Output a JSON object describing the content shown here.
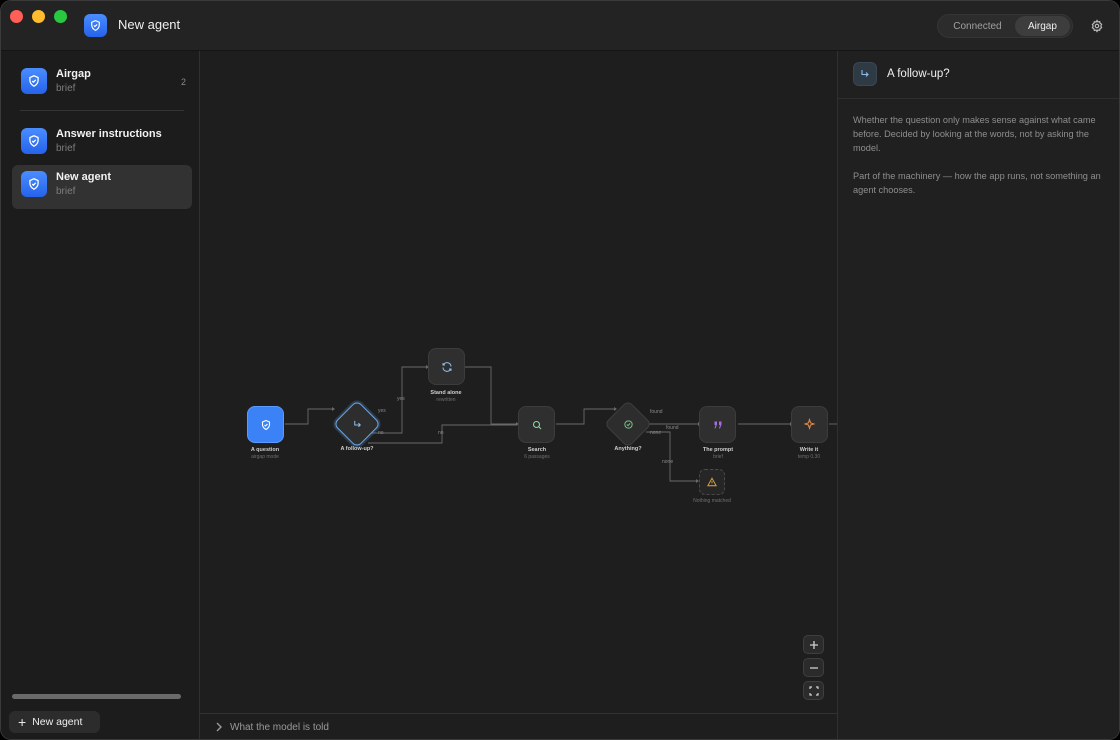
{
  "window": {
    "title": "New agent",
    "mode_options": [
      "Connected",
      "Airgap"
    ],
    "mode_selected": "Airgap"
  },
  "sidebar": {
    "agents": [
      {
        "name": "Airgap",
        "sub": "brief",
        "count": "2",
        "icon": "shield-icon"
      },
      {
        "name": "Answer instructions",
        "sub": "brief",
        "icon": "shield-icon"
      },
      {
        "name": "New agent",
        "sub": "brief",
        "icon": "shield-icon",
        "selected": true
      }
    ],
    "new_agent_label": "New agent"
  },
  "flow": {
    "nodes": [
      {
        "label": "A question",
        "sub": "airgap mode",
        "icon": "shield-icon"
      },
      {
        "label": "A follow-up?",
        "sub": "",
        "icon": "arrow-turn-icon"
      },
      {
        "label": "Stand alone",
        "sub": "rewritten",
        "icon": "refresh-icon"
      },
      {
        "label": "Search",
        "sub": "6 passages",
        "icon": "search-icon"
      },
      {
        "label": "Anything?",
        "sub": "",
        "icon": "check-circle-icon"
      },
      {
        "label": "The prompt",
        "sub": "brief",
        "icon": "quote-icon"
      },
      {
        "label": "Write it",
        "sub": "temp 0.30",
        "icon": "sparkle-icon"
      },
      {
        "label": "Nothing matched",
        "sub": "",
        "icon": "warning-icon"
      }
    ],
    "edge_labels": {
      "yes": "yes",
      "no": "no",
      "found": "found",
      "none": "none"
    }
  },
  "bottom_bar": {
    "label": "What the model is told"
  },
  "panel": {
    "title": "A follow-up?",
    "paragraph1": "Whether the question only makes sense against what came before. Decided by looking at the words, not by asking the model.",
    "paragraph2": "Part of the machinery — how the app runs, not something an agent chooses."
  },
  "colors": {
    "accent": "#3b82f6",
    "selected_outline": "#6aa7e6"
  }
}
